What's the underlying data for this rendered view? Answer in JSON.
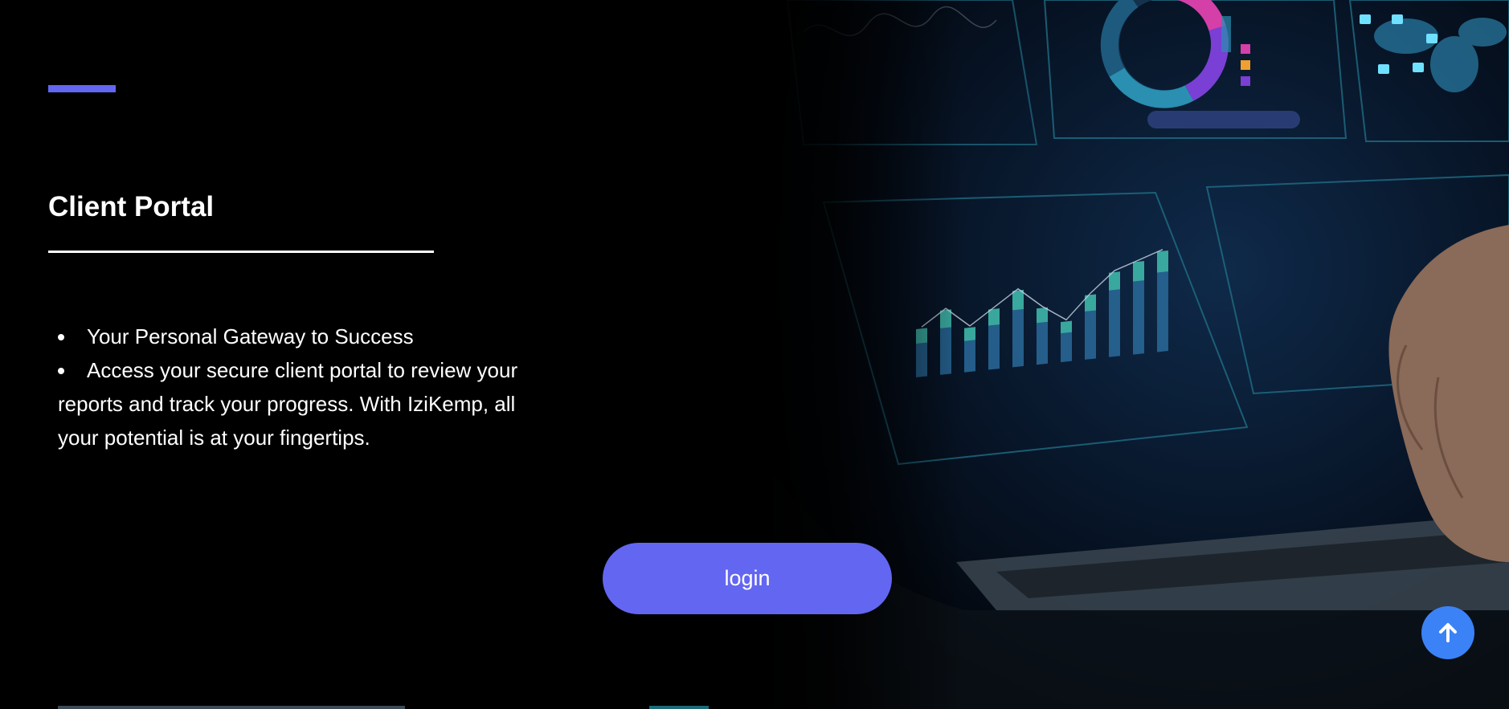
{
  "portal": {
    "title": "Client Portal",
    "bullets": [
      "Your Personal Gateway to Success",
      "Access your secure client portal to review your reports and track your progress. With IziKemp, all your potential is at your fingertips."
    ],
    "login_label": "login"
  },
  "icons": {
    "scroll_top": "arrow-up-icon"
  },
  "colors": {
    "accent": "#6366f1",
    "scroll_button": "#3b82f6",
    "background": "#000000",
    "text": "#ffffff"
  }
}
